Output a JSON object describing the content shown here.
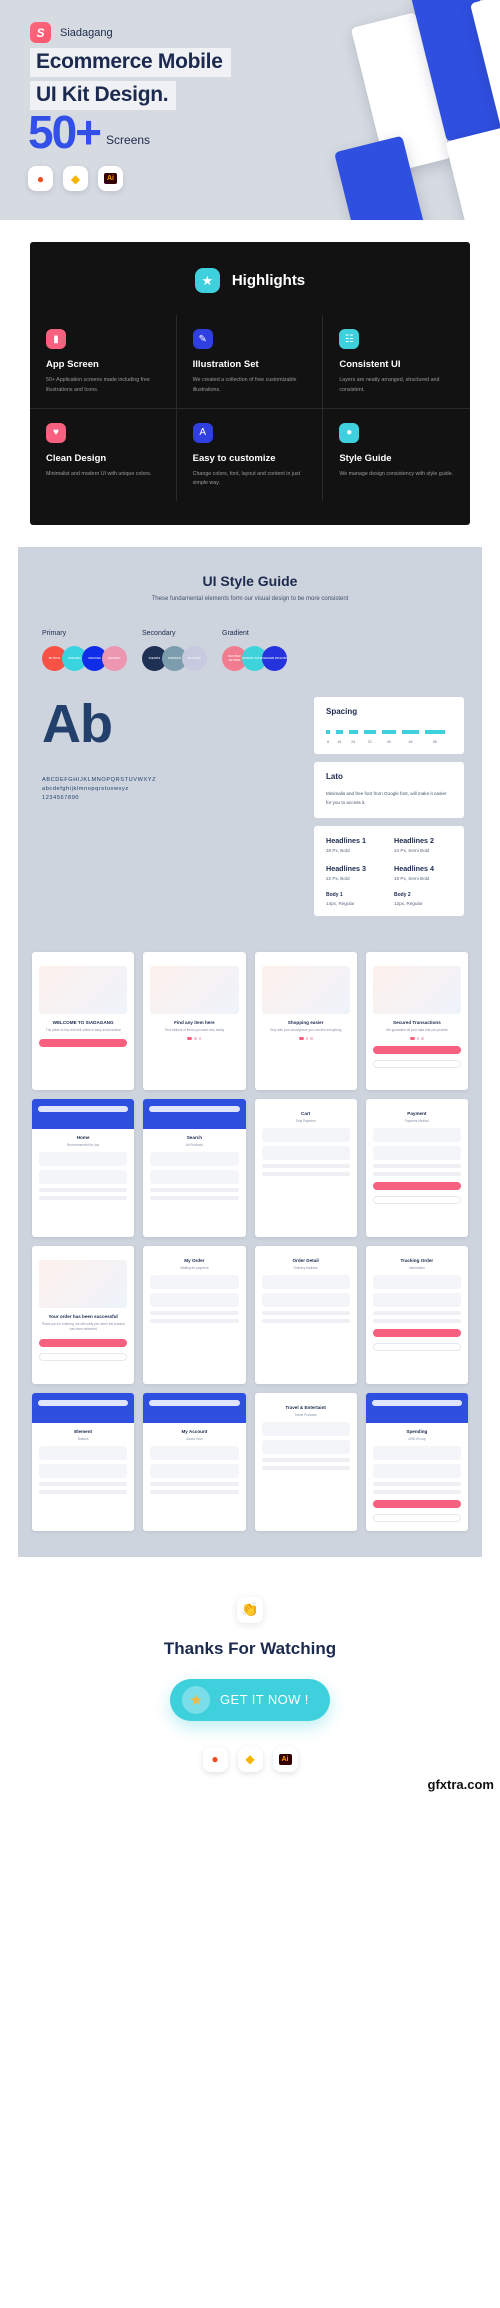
{
  "hero": {
    "brand_name": "Siadagang",
    "brand_logo_glyph": "S",
    "title_line1": "Ecommerce Mobile",
    "title_line2": "UI Kit Design.",
    "count": "50+",
    "count_label": "Screens",
    "tools": [
      {
        "name": "figma-icon",
        "glyph": "◐"
      },
      {
        "name": "sketch-icon",
        "glyph": "◆"
      },
      {
        "name": "illustrator-icon",
        "glyph": "Ai"
      }
    ]
  },
  "highlights": {
    "badge_glyph": "★",
    "title": "Highlights",
    "cards": [
      {
        "title": "App Screen",
        "desc": "50+ Application screens made including free illustrations and Icons.",
        "color": "#f8607f",
        "glyph": "▮"
      },
      {
        "title": "Illustration Set",
        "desc": "We created a collection of free customizable illustrations.",
        "color": "#2f3fe0",
        "glyph": "✎"
      },
      {
        "title": "Consistent UI",
        "desc": "Layers are neatly arranged, structured and consistent.",
        "color": "#3fd0dd",
        "glyph": "☷"
      },
      {
        "title": "Clean Design",
        "desc": "Minimalist and modern UI with unique colors.",
        "color": "#f8607f",
        "glyph": "♥"
      },
      {
        "title": "Easy to customize",
        "desc": "Change colors, font, layout and content in just simple way.",
        "color": "#2f3fe0",
        "glyph": "A"
      },
      {
        "title": "Style Guide",
        "desc": "We manage design consistency with style guide.",
        "color": "#3fd0dd",
        "glyph": "●"
      }
    ]
  },
  "style_guide": {
    "title": "UI Style Guide",
    "subtitle": "These fundamental elements form our visual design to be more consistent",
    "palettes": [
      {
        "label": "Primary",
        "swatches": [
          {
            "hex": "#F75243",
            "label": "#F75243"
          },
          {
            "hex": "#3AD4E0",
            "label": "#3AD4E0"
          },
          {
            "hex": "#0F2CE9",
            "label": "#0F2CE9"
          },
          {
            "hex": "#EC96AF",
            "label": "#EC96AF"
          }
        ]
      },
      {
        "label": "Secondary",
        "swatches": [
          {
            "hex": "#1E3054",
            "label": "#1E3054"
          },
          {
            "hex": "#7B9DAD",
            "label": "#7B9DAD"
          },
          {
            "hex": "#C7CADF",
            "label": "#C7CADF"
          }
        ]
      },
      {
        "label": "Gradient",
        "swatches": [
          {
            "hex": "#F17B8F",
            "label": "#EC78AF #E7939F"
          },
          {
            "hex": "#3ED3DB",
            "label": "#35E39F #3AD4E0"
          },
          {
            "hex": "#2433DE",
            "label": "#1E064B #0F2C80"
          }
        ]
      }
    ],
    "typography": {
      "specimen": "Ab",
      "alphabet_upper": "ABCDEFGHIJKLMNOPQRSTUVWXYZ",
      "alphabet_lower": "abcdefghijklmnopqrstuvwxyz",
      "numerals": "1234567890",
      "spacing": {
        "title": "Spacing",
        "values": [
          "8",
          "16",
          "24",
          "32",
          "40",
          "48",
          "56"
        ]
      },
      "font": {
        "name": "Lato",
        "desc": "Minimalis and free font from Google font, will make it easier for you to access it."
      },
      "scale": [
        {
          "name": "Headlines 1",
          "spec": "28 Px, Bold"
        },
        {
          "name": "Headlines 2",
          "spec": "24 Px, Semi Bold"
        },
        {
          "name": "Headlines 3",
          "spec": "22 Px, Bold"
        },
        {
          "name": "Headlines 4",
          "spec": "18 Px, Semi Bold"
        },
        {
          "name": "Body 1",
          "spec": "14px, Regular"
        },
        {
          "name": "Body 2",
          "spec": "12px, Regular"
        }
      ]
    }
  },
  "screens": [
    [
      {
        "title": "WELCOME TO SIADAGANG",
        "desc": "The place to buy and sell online is easy and practical",
        "style": "splash"
      },
      {
        "title": "Find any item here",
        "desc": "Find millions of items you want very easily",
        "style": "onboard"
      },
      {
        "title": "Shopping easier",
        "desc": "Only with your smartphone you can find everything",
        "style": "onboard"
      },
      {
        "title": "Secured Transactions",
        "desc": "We guarantee all your data that you provide",
        "style": "onboard"
      }
    ],
    [
      {
        "title": "Home",
        "desc": "Recommended for you",
        "style": "app-nav"
      },
      {
        "title": "Search",
        "desc": "All Products",
        "style": "app-nav"
      },
      {
        "title": "Cart",
        "desc": "Total Payment",
        "style": "app-plain"
      },
      {
        "title": "Payment",
        "desc": "Payment Method",
        "style": "app-plain"
      }
    ],
    [
      {
        "title": "Your order has been successful",
        "desc": "Thank you for ordering, we will notify you when the product has been delivered",
        "style": "result"
      },
      {
        "title": "My Order",
        "desc": "Waiting for payment",
        "style": "app-plain"
      },
      {
        "title": "Order Detail",
        "desc": "Delivery Address",
        "style": "app-plain"
      },
      {
        "title": "Tracking Order",
        "desc": "Information",
        "style": "app-plain"
      }
    ],
    [
      {
        "title": "Element",
        "desc": "Buttons",
        "style": "app-nav"
      },
      {
        "title": "My Account",
        "desc": "Adara Yosh",
        "style": "app-nav"
      },
      {
        "title": "Travel & Entertaint",
        "desc": "Travel Products",
        "style": "app-plain"
      },
      {
        "title": "Spending",
        "desc": "4292.00 usp",
        "style": "app-nav"
      }
    ]
  ],
  "footer": {
    "clap_glyph": "👏",
    "thanks": "Thanks For Watching",
    "cta_label": "GET IT NOW !",
    "cta_star": "★",
    "watermark": "gfxtra.com",
    "tools": [
      {
        "name": "figma-icon",
        "glyph": "◐"
      },
      {
        "name": "sketch-icon",
        "glyph": "◆"
      },
      {
        "name": "illustrator-icon",
        "glyph": "Ai"
      }
    ]
  }
}
